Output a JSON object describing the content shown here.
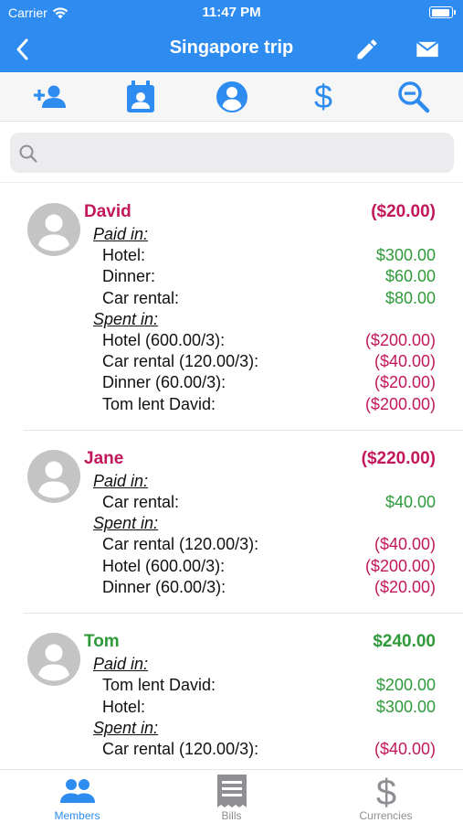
{
  "status_bar": {
    "carrier": "Carrier",
    "time": "11:47 PM",
    "battery_level": 0.95
  },
  "nav": {
    "title": "Singapore trip"
  },
  "search": {
    "placeholder": "",
    "value": ""
  },
  "colors": {
    "accent": "#2e8cf0",
    "negative": "#c2185b",
    "positive": "#2e9a3a",
    "inactive": "#8e8e93"
  },
  "members": [
    {
      "name": "David",
      "total": "($20.00)",
      "total_status": "negative",
      "paid_label": "Paid in:",
      "paid": [
        {
          "label": "Hotel:",
          "amount": "$300.00"
        },
        {
          "label": "Dinner:",
          "amount": "$60.00"
        },
        {
          "label": "Car rental:",
          "amount": "$80.00"
        }
      ],
      "spent_label": "Spent in:",
      "spent": [
        {
          "label": "Hotel (600.00/3):",
          "amount": "($200.00)"
        },
        {
          "label": "Car rental (120.00/3):",
          "amount": "($40.00)"
        },
        {
          "label": "Dinner (60.00/3):",
          "amount": "($20.00)"
        },
        {
          "label": "Tom lent David:",
          "amount": "($200.00)"
        }
      ]
    },
    {
      "name": "Jane",
      "total": "($220.00)",
      "total_status": "negative",
      "paid_label": "Paid in:",
      "paid": [
        {
          "label": "Car rental:",
          "amount": "$40.00"
        }
      ],
      "spent_label": "Spent in:",
      "spent": [
        {
          "label": "Car rental (120.00/3):",
          "amount": "($40.00)"
        },
        {
          "label": "Hotel (600.00/3):",
          "amount": "($200.00)"
        },
        {
          "label": "Dinner (60.00/3):",
          "amount": "($20.00)"
        }
      ]
    },
    {
      "name": "Tom",
      "total": "$240.00",
      "total_status": "positive",
      "paid_label": "Paid in:",
      "paid": [
        {
          "label": "Tom lent David:",
          "amount": "$200.00"
        },
        {
          "label": "Hotel:",
          "amount": "$300.00"
        }
      ],
      "spent_label": "Spent in:",
      "spent": [
        {
          "label": "Car rental (120.00/3):",
          "amount": "($40.00)"
        }
      ]
    }
  ],
  "tabs": [
    {
      "label": "Members",
      "icon": "members-icon",
      "active": true
    },
    {
      "label": "Bills",
      "icon": "bills-icon",
      "active": false
    },
    {
      "label": "Currencies",
      "icon": "currencies-icon",
      "active": false
    }
  ]
}
